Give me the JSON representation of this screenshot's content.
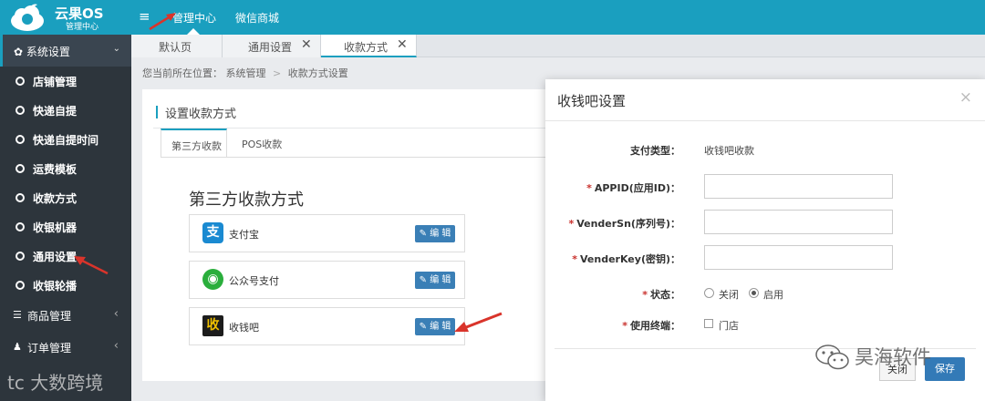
{
  "header": {
    "logo_title": "云果OS",
    "logo_subtitle": "管理中心",
    "nav": [
      "管理中心",
      "微信商城"
    ]
  },
  "sidebar": {
    "active_group": "系统设置",
    "items": [
      "店铺管理",
      "快递自提",
      "快递自提时间",
      "运费模板",
      "收款方式",
      "收银机器",
      "通用设置",
      "收银轮播"
    ],
    "collapsed_groups": [
      "商品管理",
      "订单管理"
    ]
  },
  "tabs": [
    {
      "label": "默认页",
      "closable": false
    },
    {
      "label": "通用设置",
      "closable": true
    },
    {
      "label": "收款方式",
      "closable": true,
      "active": true
    }
  ],
  "breadcrumb": {
    "prefix": "您当前所在位置：",
    "path": [
      "系统管理",
      "收款方式设置"
    ],
    "separator": ">"
  },
  "panel": {
    "title": "设置收款方式",
    "inner_tabs": [
      "第三方收款",
      "POS收款"
    ],
    "section_title": "第三方收款方式",
    "edit_label": "编 辑",
    "methods": [
      {
        "name": "支付宝",
        "icon": "alipay-icon",
        "color": "#1a8ad1",
        "glyph": "支"
      },
      {
        "name": "公众号支付",
        "icon": "wechat-icon",
        "color": "#2aae3c",
        "glyph": "◉"
      },
      {
        "name": "收钱吧",
        "icon": "shouqianba-icon",
        "color": "#1c1c1c",
        "glyph": "收"
      }
    ]
  },
  "modal": {
    "title": "收钱吧设置",
    "fields": {
      "pay_type_label": "支付类型：",
      "pay_type_value": "收钱吧收款",
      "appid_label": "APPID(应用ID)：",
      "appid_value": "",
      "vendersn_label": "VenderSn(序列号)：",
      "vendersn_value": "",
      "venderkey_label": "VenderKey(密钥)：",
      "venderkey_value": "",
      "status_label": "状态：",
      "status_options": [
        "关闭",
        "启用"
      ],
      "status_selected": "启用",
      "terminal_label": "使用终端：",
      "terminal_option": "门店",
      "terminal_checked": false
    },
    "buttons": {
      "close": "关闭",
      "save": "保存"
    }
  },
  "watermarks": {
    "right": "昊海软件",
    "left": "大数跨境"
  },
  "colors": {
    "topbar": "#1a9fbf",
    "sidebar": "#2d353c",
    "primary_button": "#337ab7",
    "required_mark": "#c9302c",
    "arrow": "#d9342b"
  }
}
